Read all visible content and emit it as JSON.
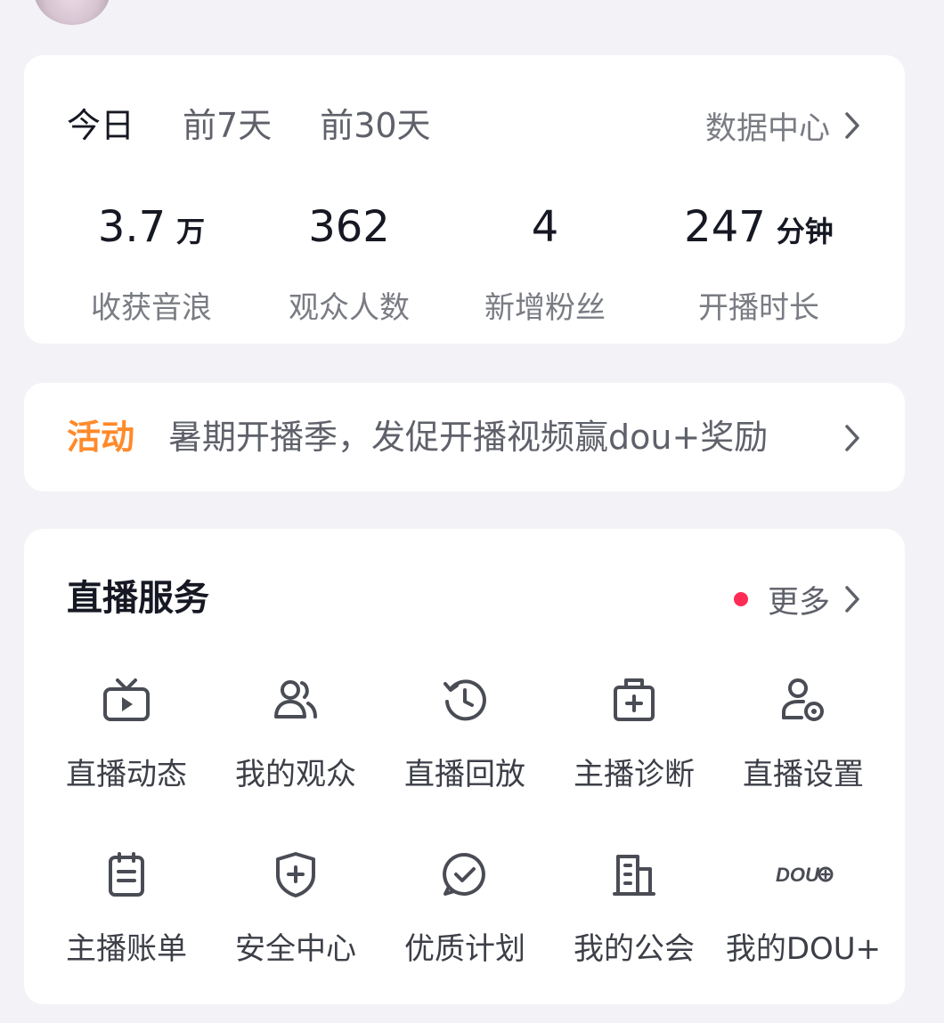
{
  "stats": {
    "tabs": [
      "今日",
      "前7天",
      "前30天"
    ],
    "data_center_label": "数据中心",
    "metrics": [
      {
        "value": "3.7",
        "unit": "万",
        "label": "收获音浪"
      },
      {
        "value": "362",
        "unit": "",
        "label": "观众人数"
      },
      {
        "value": "4",
        "unit": "",
        "label": "新增粉丝"
      },
      {
        "value": "247",
        "unit": "分钟",
        "label": "开播时长"
      }
    ]
  },
  "activity": {
    "tag": "活动",
    "text": "暑期开播季，发促开播视频赢dou+奖励"
  },
  "services": {
    "title": "直播服务",
    "more_label": "更多",
    "items": [
      {
        "label": "直播动态",
        "icon": "tv-play-icon"
      },
      {
        "label": "我的观众",
        "icon": "audience-icon"
      },
      {
        "label": "直播回放",
        "icon": "replay-clock-icon"
      },
      {
        "label": "主播诊断",
        "icon": "medical-kit-icon"
      },
      {
        "label": "直播设置",
        "icon": "user-settings-icon"
      },
      {
        "label": "主播账单",
        "icon": "bill-icon"
      },
      {
        "label": "安全中心",
        "icon": "shield-plus-icon"
      },
      {
        "label": "优质计划",
        "icon": "check-chat-icon"
      },
      {
        "label": "我的公会",
        "icon": "building-icon"
      },
      {
        "label": "我的DOU+",
        "icon": "dou-plus-icon"
      }
    ],
    "dou_icon_text": "DOU"
  },
  "colors": {
    "accent_orange": "#ff8a2b",
    "badge_red": "#fe2c55",
    "tab_underline": "#fc9fb5"
  }
}
